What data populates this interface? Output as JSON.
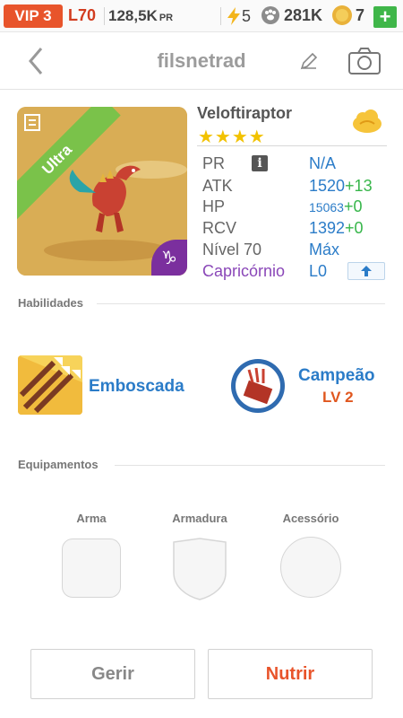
{
  "status_bar": {
    "vip": "VIP 3",
    "level": "L70",
    "pr_value": "128,5K",
    "pr_unit": "PR",
    "energy": "5",
    "food": "281K",
    "coins": "7",
    "add_label": "+"
  },
  "header": {
    "title": "filsnetrad"
  },
  "dinosaur": {
    "name": "Veloftiraptor",
    "stars": "★★★★",
    "rarity": "Ultra",
    "zodiac_symbol": "♑",
    "stats": [
      {
        "label": "PR",
        "value": "N/A"
      },
      {
        "label": "ATK",
        "value": "1520",
        "bonus": "+13"
      },
      {
        "label": "HP",
        "value": "15063",
        "bonus": "+0"
      },
      {
        "label": "RCV",
        "value": "1392",
        "bonus": "+0"
      },
      {
        "label": "Nível 70",
        "value": "Máx"
      },
      {
        "label": "Capricórnio",
        "value": "L0"
      }
    ],
    "info_glyph": "i"
  },
  "skills": {
    "title": "Habilidades",
    "items": [
      {
        "name": "Emboscada"
      },
      {
        "name": "Campeão",
        "level": "LV 2"
      }
    ]
  },
  "equipment": {
    "title": "Equipamentos",
    "slots": [
      "Arma",
      "Armadura",
      "Acessório"
    ]
  },
  "actions": {
    "manage": "Gerir",
    "feed": "Nutrir"
  },
  "colors": {
    "accent_orange": "#e8542b",
    "link_blue": "#2b7cc8",
    "bonus_green": "#37b64a",
    "zodiac_purple": "#8a47b8",
    "star_gold": "#f2c200"
  }
}
